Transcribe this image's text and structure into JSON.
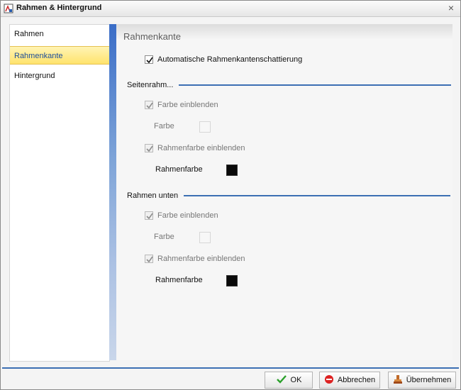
{
  "window": {
    "title": "Rahmen & Hintergrund"
  },
  "nav": {
    "items": [
      {
        "label": "Rahmen"
      },
      {
        "label": "Rahmenkante"
      },
      {
        "label": "Hintergrund"
      }
    ],
    "selected": "Rahmenkante"
  },
  "main": {
    "title": "Rahmenkante",
    "auto_shading": {
      "label": "Automatische Rahmenkantenschattierung",
      "checked": true
    }
  },
  "sections": [
    {
      "title": "Seitenrahm...",
      "show_color": {
        "label": "Farbe einblenden",
        "checked": true,
        "disabled": true
      },
      "color_label": "Farbe",
      "show_frame_color": {
        "label": "Rahmenfarbe einblenden",
        "checked": true,
        "disabled": true
      },
      "frame_color_label": "Rahmenfarbe",
      "frame_color": "#0a0a0a"
    },
    {
      "title": "Rahmen unten",
      "show_color": {
        "label": "Farbe einblenden",
        "checked": true,
        "disabled": true
      },
      "color_label": "Farbe",
      "show_frame_color": {
        "label": "Rahmenfarbe einblenden",
        "checked": true,
        "disabled": true
      },
      "frame_color_label": "Rahmenfarbe",
      "frame_color": "#0a0a0a"
    }
  ],
  "footer": {
    "ok": "OK",
    "cancel": "Abbrechen",
    "apply": "Übernehmen"
  },
  "colors": {
    "accent": "#3c6fb3",
    "selected_bg": "#ffe36c",
    "selected_text": "#1d4e9a"
  }
}
